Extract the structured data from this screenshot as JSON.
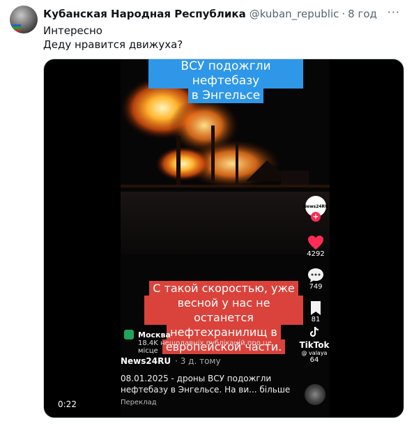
{
  "tweet": {
    "author_name": "Кубанская Народная Республика",
    "handle": "@kuban_republic",
    "separator": "·",
    "time": "8 год",
    "more_icon": "more-dots-icon",
    "text_line1": "Интересно",
    "text_line2": "Деду нравится движуха?"
  },
  "video": {
    "caption_top_line1": "ВСУ подожгли нефтебазу",
    "caption_top_line2": "в Энгельсе",
    "caption_mid_line1": "С такой скоростью, уже",
    "caption_mid_line2": "весной у нас не останется",
    "caption_mid_line3": "нефтехранилищ в",
    "caption_mid_line4": "европейской части.",
    "location_title": "Москва",
    "location_sub": "18.4K нещодавніх публікацій про це місце",
    "source_name": "News24RU",
    "source_ago": "· 3 д. тому",
    "desc_line1": "08.01.2025 - дроны ВСУ подожгли",
    "desc_line2": "нефтебазу в Энгельсе.  На ви... більше",
    "translate": "Переклад",
    "profile_label": "News24RU",
    "likes": "4292",
    "comments": "749",
    "saves": "81",
    "tiktok_brand": "TikTok",
    "tiktok_user": "@ valaya",
    "shares": "64",
    "duration": "0:22",
    "colors": {
      "caption_blue": "#2f97e8",
      "caption_red": "#d9433b",
      "like_red": "#fe2c55"
    }
  }
}
